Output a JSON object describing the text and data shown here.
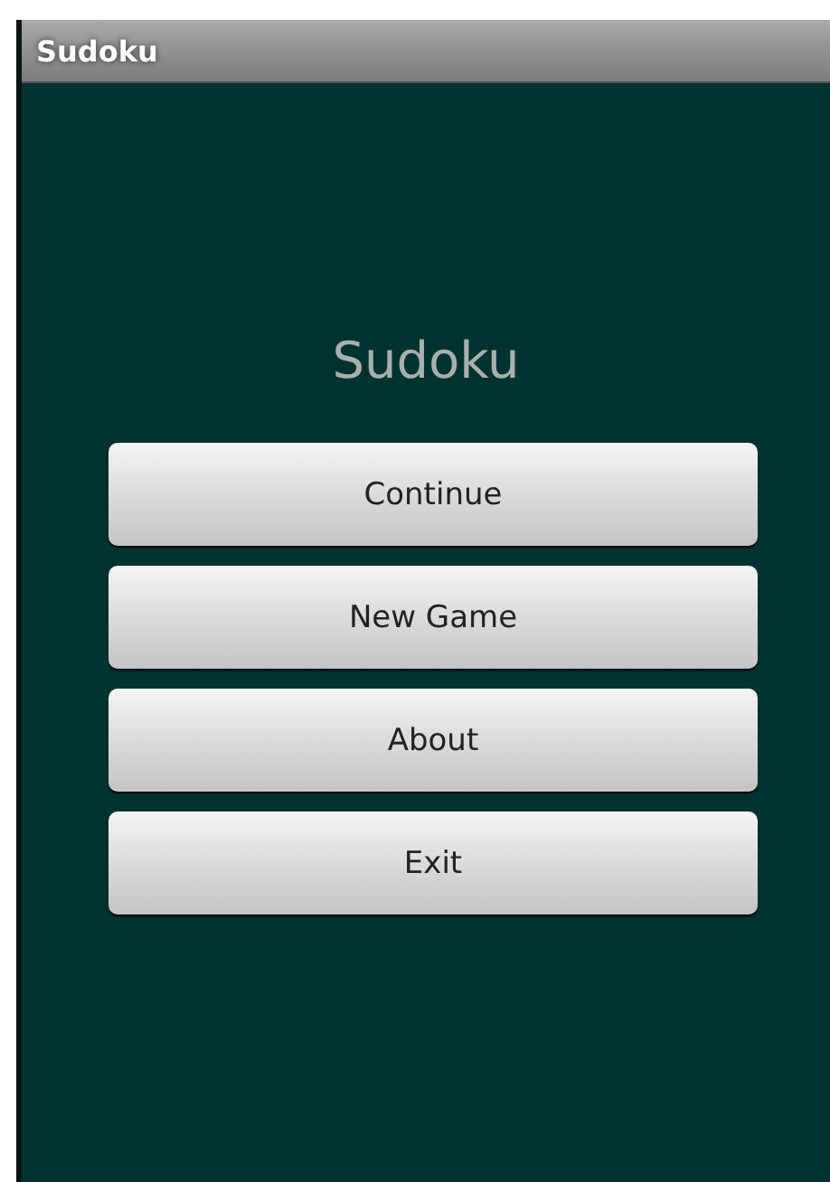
{
  "window": {
    "title": "Sudoku"
  },
  "heading": "Sudoku",
  "buttons": [
    "Continue",
    "New Game",
    "About",
    "Exit"
  ]
}
